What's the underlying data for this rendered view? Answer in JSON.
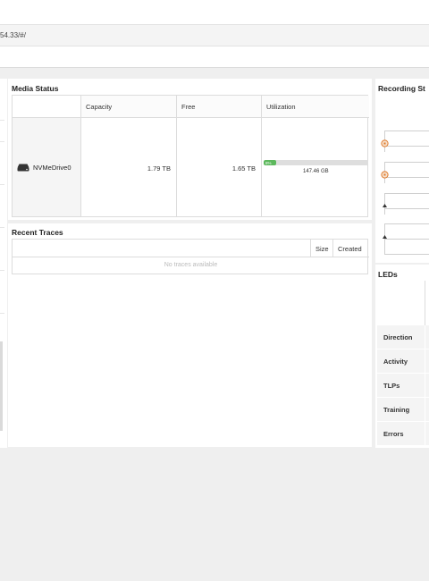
{
  "browser": {
    "url": "54.33/#/"
  },
  "media_status": {
    "title": "Media Status",
    "columns": [
      "",
      "Capacity",
      "Free",
      "Utilization"
    ],
    "rows": [
      {
        "drive_name": "NVMeDrive0",
        "capacity": "1.79 TB",
        "free": "1.65 TB",
        "utilization_percent": 8,
        "utilization_label": "8%",
        "used": "147.46 GB"
      }
    ]
  },
  "recent_traces": {
    "title": "Recent Traces",
    "columns": [
      "",
      "Size",
      "Created"
    ],
    "empty_message": "No traces available"
  },
  "recording": {
    "title": "Recording St"
  },
  "leds": {
    "title": "LEDs",
    "rows": [
      "Direction",
      "Activity",
      "TLPs",
      "Training",
      "Errors"
    ]
  },
  "colors": {
    "accent_green": "#5cb85c",
    "marker_orange": "#e07a2a"
  }
}
